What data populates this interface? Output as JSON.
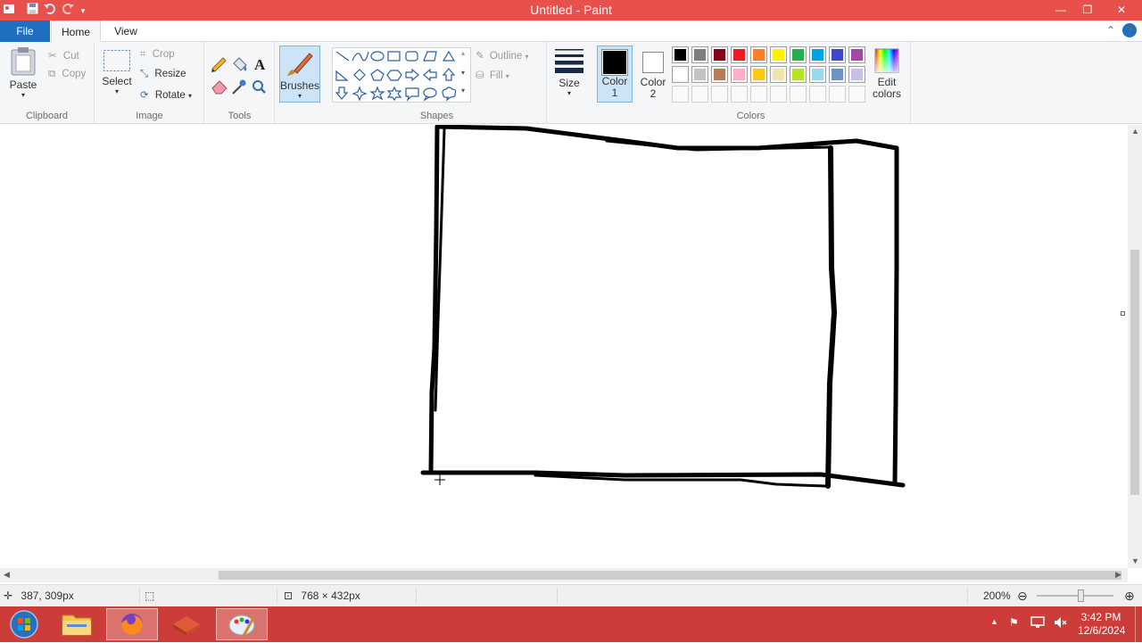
{
  "window": {
    "title": "Untitled - Paint",
    "qat_icons": [
      "paint-app-icon",
      "save-icon",
      "undo-icon",
      "redo-icon",
      "customize-qat-icon"
    ],
    "controls": [
      "minimize-icon",
      "maximize-icon",
      "close-icon"
    ]
  },
  "tabs": {
    "file": "File",
    "home": "Home",
    "view": "View"
  },
  "ribbon": {
    "clipboard": {
      "label": "Clipboard",
      "paste": "Paste",
      "cut": "Cut",
      "copy": "Copy"
    },
    "image": {
      "label": "Image",
      "select": "Select",
      "crop": "Crop",
      "resize": "Resize",
      "rotate": "Rotate"
    },
    "tools": {
      "label": "Tools",
      "items": [
        "pencil-icon",
        "fill-icon",
        "text-icon",
        "eraser-icon",
        "color-picker-icon",
        "magnifier-icon"
      ]
    },
    "brushes": {
      "label": "Brushes"
    },
    "shapes": {
      "label": "Shapes",
      "outline": "Outline",
      "fill": "Fill"
    },
    "size": {
      "label": "Size"
    },
    "colors": {
      "label": "Colors",
      "color1_line1": "Color",
      "color1_line2": "1",
      "color2_line1": "Color",
      "color2_line2": "2",
      "edit_line1": "Edit",
      "edit_line2": "colors",
      "color1_value": "#000000",
      "color2_value": "#ffffff",
      "palette_row1": [
        "#000000",
        "#7f7f7f",
        "#880015",
        "#ed1c24",
        "#ff7f27",
        "#fff200",
        "#22b14c",
        "#00a2e8",
        "#3f48cc",
        "#a349a4"
      ],
      "palette_row2": [
        "#ffffff",
        "#c3c3c3",
        "#b97a57",
        "#ffaec9",
        "#ffc90e",
        "#efe4b0",
        "#b5e61d",
        "#99d9ea",
        "#7092be",
        "#c8bfe7"
      ],
      "palette_row3_custom_slots": 10
    }
  },
  "status": {
    "cursor_position": "387, 309px",
    "canvas_size": "768 × 432px",
    "zoom": "200%"
  },
  "taskbar": {
    "apps": [
      "start-button",
      "file-explorer-icon",
      "firefox-icon",
      "app-icon",
      "paint-icon"
    ],
    "time": "3:42 PM",
    "date": "12/6/2024"
  }
}
